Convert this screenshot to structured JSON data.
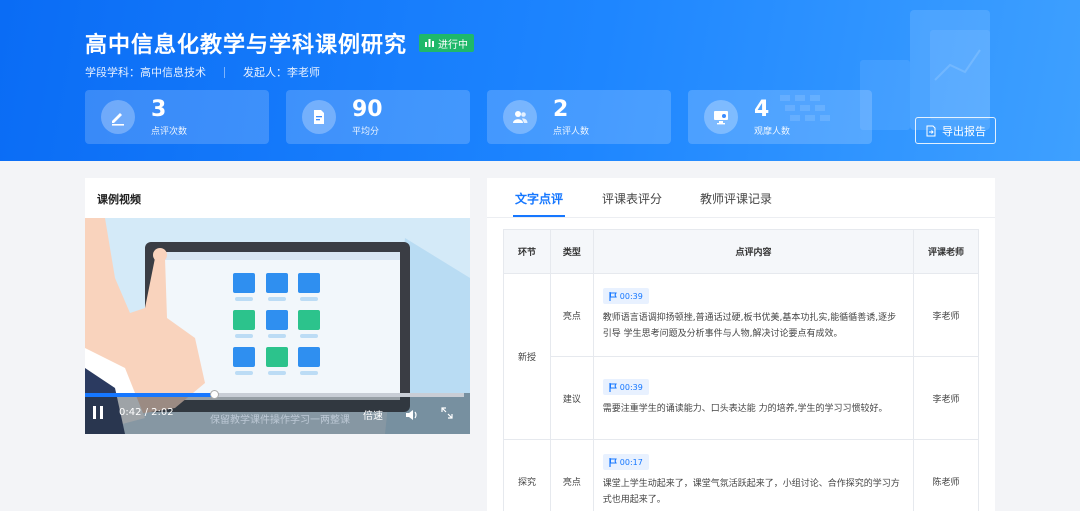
{
  "header": {
    "title": "高中信息化教学与学科课例研究",
    "status": "进行中",
    "subject_label": "学段学科：高中信息技术",
    "initiator_label": "发起人：李老师",
    "export_label": "导出报告"
  },
  "stats": [
    {
      "value": "3",
      "label": "点评次数",
      "icon": "edit-icon"
    },
    {
      "value": "90",
      "label": "平均分",
      "icon": "score-doc-icon"
    },
    {
      "value": "2",
      "label": "点评人数",
      "icon": "users-icon"
    },
    {
      "value": "4",
      "label": "观摩人数",
      "icon": "monitor-icon"
    }
  ],
  "video": {
    "panel_title": "课例视频",
    "time": "0:42 / 2:02",
    "progress": 0.344,
    "subtitle": "保留教学课件操作学习一两整课",
    "speed_label": "倍速"
  },
  "tabs": [
    {
      "label": "文字点评",
      "active": true
    },
    {
      "label": "评课表评分",
      "active": false
    },
    {
      "label": "教师评课记录",
      "active": false
    }
  ],
  "table": {
    "headers": [
      "环节",
      "类型",
      "点评内容",
      "评课老师"
    ],
    "rows": [
      {
        "stage": "新授",
        "type": "亮点",
        "time": "00:39",
        "content": "教师语言语调抑扬顿挫,普通话过硬,板书优美,基本功扎实,能循循善诱,逐步引导 学生思考问题及分析事件与人物,解决讨论要点有成效。",
        "teacher": "李老师"
      },
      {
        "stage": "",
        "type": "建议",
        "time": "00:39",
        "content": "需要注重学生的诵读能力、口头表达能 力的培养,学生的学习习惯较好。",
        "teacher": "李老师"
      },
      {
        "stage": "探究",
        "type": "亮点",
        "time": "00:17",
        "content": "课堂上学生动起来了，课堂气氛活跃起来了，小组讨论、合作探究的学习方式也用起来了。",
        "teacher": "陈老师"
      }
    ]
  },
  "colors": {
    "accent": "#1677ff",
    "good": "#2bae5b",
    "suggest": "#f59a23",
    "status": "#1fb86a"
  }
}
